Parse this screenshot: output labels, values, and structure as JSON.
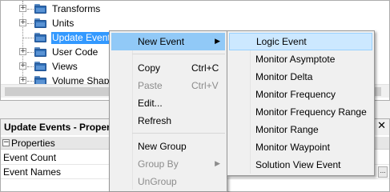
{
  "tree": {
    "items": [
      {
        "label": "Transforms",
        "expander": "+"
      },
      {
        "label": "Units",
        "expander": "+"
      },
      {
        "label": "Update Events",
        "expander": "",
        "selected": true
      },
      {
        "label": "User Code",
        "expander": "+"
      },
      {
        "label": "Views",
        "expander": "+"
      },
      {
        "label": "Volume Shapes",
        "expander": "+"
      }
    ]
  },
  "properties": {
    "title": "Update Events - Properties",
    "close_glyph": "✕",
    "category": {
      "toggle": "−",
      "label": "Properties"
    },
    "rows": [
      {
        "name": "Event Count"
      },
      {
        "name": "Event Names",
        "button": "..."
      }
    ]
  },
  "context_menu": {
    "items": [
      {
        "label": "New Event",
        "submenu_arrow": "▶",
        "state": "active"
      },
      {
        "label": "Copy",
        "shortcut": "Ctrl+C"
      },
      {
        "label": "Paste",
        "shortcut": "Ctrl+V",
        "disabled": true
      },
      {
        "label": "Edit..."
      },
      {
        "label": "Refresh"
      },
      {
        "label": "New Group"
      },
      {
        "label": "Group By",
        "submenu_arrow": "▶",
        "disabled": true
      },
      {
        "label": "UnGroup",
        "disabled": true
      }
    ]
  },
  "submenu": {
    "items": [
      {
        "label": "Logic Event",
        "state": "hover"
      },
      {
        "label": "Monitor Asymptote"
      },
      {
        "label": "Monitor Delta"
      },
      {
        "label": "Monitor Frequency"
      },
      {
        "label": "Monitor Frequency Range"
      },
      {
        "label": "Monitor Range"
      },
      {
        "label": "Monitor Waypoint"
      },
      {
        "label": "Solution View Event"
      }
    ]
  },
  "colors": {
    "selection": "#3399ff",
    "menu_active": "#91c9f7",
    "menu_hover": "#cce8ff",
    "folder": "#2f6db4"
  }
}
